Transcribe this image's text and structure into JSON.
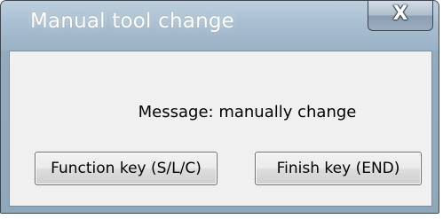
{
  "window": {
    "title": "Manual tool change",
    "close_glyph": "X",
    "close_icon": "close-icon"
  },
  "dialog": {
    "message": "Message: manually change",
    "buttons": {
      "function_key": "Function key (S/L/C)",
      "finish_key": "Finish key (END)"
    }
  },
  "colors": {
    "titlebar": "#a9bfd1",
    "client_background": "#f0f0f0",
    "button_border": "#707070"
  }
}
